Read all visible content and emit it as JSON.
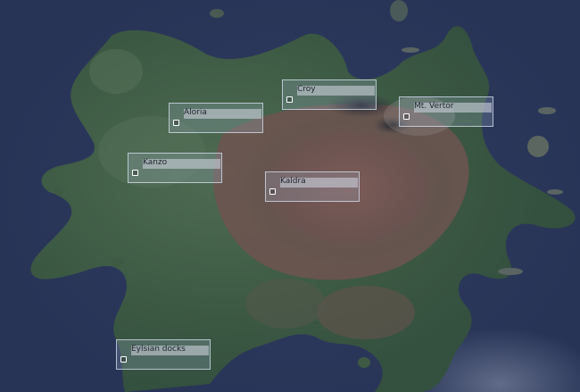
{
  "map": {
    "colors": {
      "ocean": "#283456",
      "forest": "#3d5a44",
      "desert": "#6e5450",
      "highland": "#4a4a4a"
    },
    "places": [
      {
        "id": "croy",
        "name": "Croy"
      },
      {
        "id": "mt-vertor",
        "name": "Mt. Vertor"
      },
      {
        "id": "aloria",
        "name": "Aloria"
      },
      {
        "id": "kanzo",
        "name": "Kanzo"
      },
      {
        "id": "kaldra",
        "name": "Kaldra"
      },
      {
        "id": "eylsian-docks",
        "name": "Eylsian docks"
      }
    ]
  }
}
